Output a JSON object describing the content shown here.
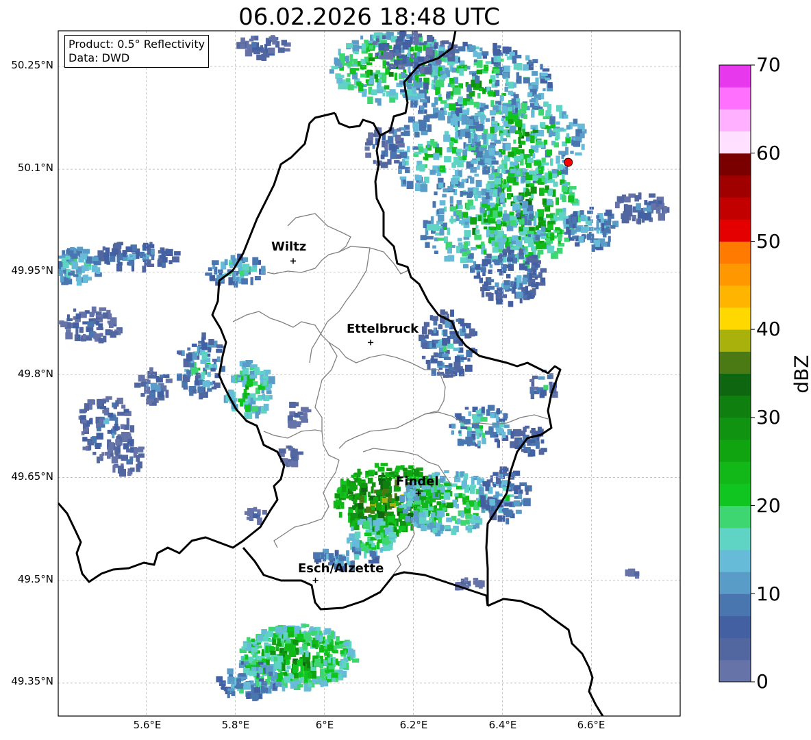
{
  "title": "06.02.2026 18:48 UTC",
  "info": {
    "product": "Product: 0.5° Reflectivity",
    "source": "Data: DWD"
  },
  "lat_ticks": [
    "50.25°N",
    "50.1°N",
    "49.95°N",
    "49.8°N",
    "49.65°N",
    "49.5°N",
    "49.35°N"
  ],
  "lon_ticks": [
    "5.6°E",
    "5.8°E",
    "6°E",
    "6.2°E",
    "6.4°E",
    "6.6°E"
  ],
  "cities": [
    {
      "name": "Wiltz",
      "lon": 5.93,
      "lat": 49.966
    },
    {
      "name": "Ettelbruck",
      "lon": 6.104,
      "lat": 49.847
    },
    {
      "name": "Findel",
      "lon": 6.211,
      "lat": 49.627
    },
    {
      "name": "Esch/Alzette",
      "lon": 5.98,
      "lat": 49.5
    }
  ],
  "radar_marker": {
    "lon": 6.548,
    "lat": 50.11,
    "color": "#ff0000"
  },
  "colorbar": {
    "label": "dBZ",
    "min": 0,
    "max": 70,
    "tick_labels": [
      "0",
      "10",
      "20",
      "30",
      "40",
      "50",
      "60",
      "70"
    ],
    "colors": [
      "#6573a8",
      "#5266a0",
      "#4360a2",
      "#4a76b0",
      "#5a9cc8",
      "#66bcd8",
      "#5fd3c4",
      "#3dd670",
      "#10c520",
      "#12b818",
      "#10a510",
      "#119312",
      "#0f8010",
      "#0e6610",
      "#4b7a14",
      "#a9b20c",
      "#ffd800",
      "#ffb400",
      "#ff9800",
      "#ff7a00",
      "#e50000",
      "#c20000",
      "#a00000",
      "#7a0000",
      "#ffe0ff",
      "#ffb0ff",
      "#ff70ff",
      "#e838ee"
    ]
  },
  "colors": {
    "border": "#000000",
    "district": "#808080",
    "grid": "#aaaaaa"
  }
}
